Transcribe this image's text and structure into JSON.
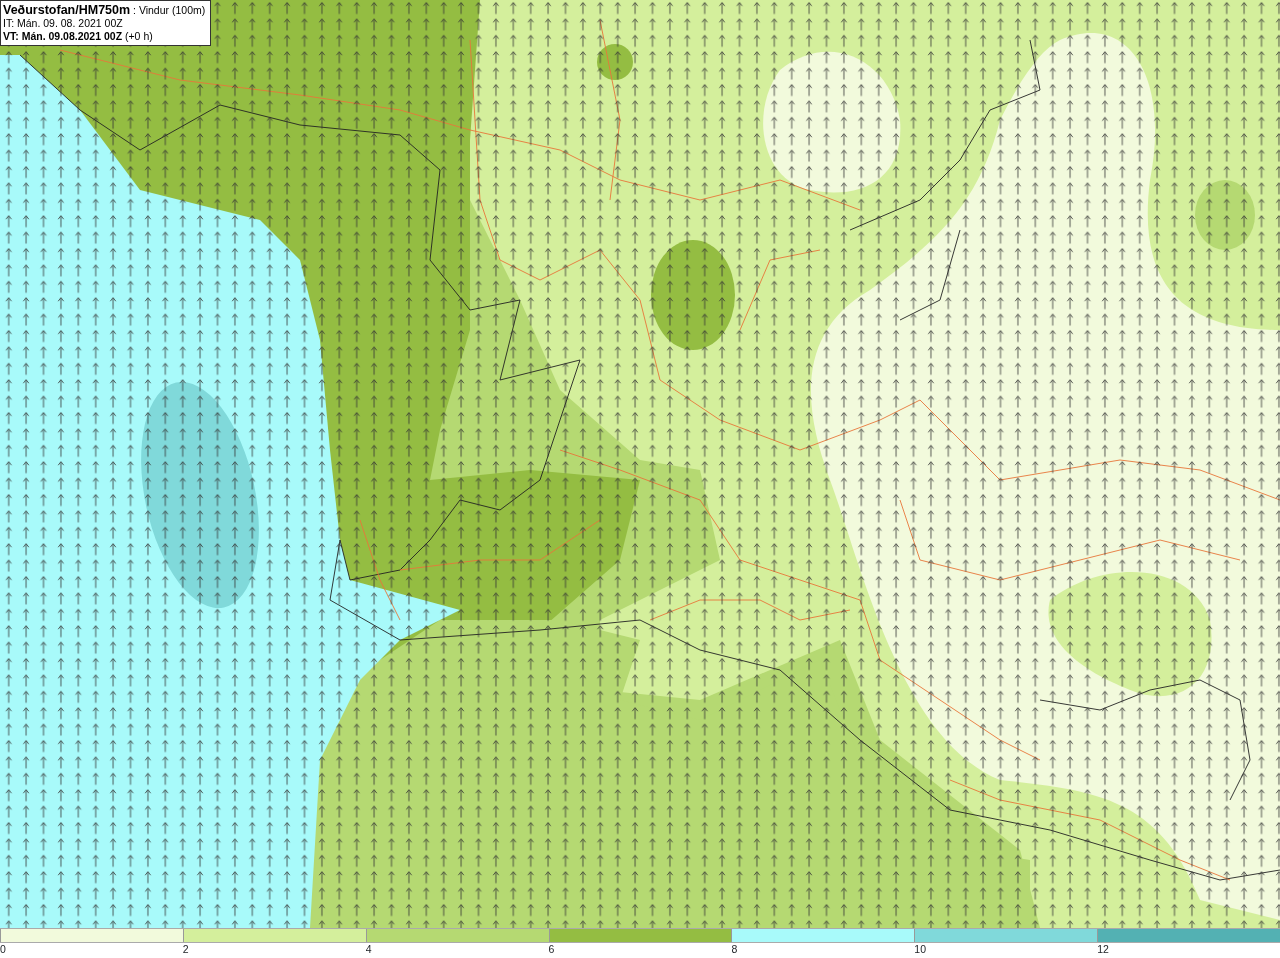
{
  "title_box": {
    "lines": [
      "**Veðurstofan/HM750m** : Vindur (100m)",
      "IT: Mán. 09. 08. 2021 00Z",
      "**VT: Mán. 09.08.2021 00Z** (+0 h)"
    ]
  },
  "legend": {
    "bins": [
      {
        "label": "0",
        "color": "#f2fadc"
      },
      {
        "label": "2",
        "color": "#d4ef9c"
      },
      {
        "label": "4",
        "color": "#b5d972"
      },
      {
        "label": "6",
        "color": "#94bd42"
      },
      {
        "label": "8",
        "color": "#a8fafa"
      },
      {
        "label": "10",
        "color": "#80d9da"
      },
      {
        "label": "12",
        "color": "#53b1b3"
      }
    ]
  }
}
